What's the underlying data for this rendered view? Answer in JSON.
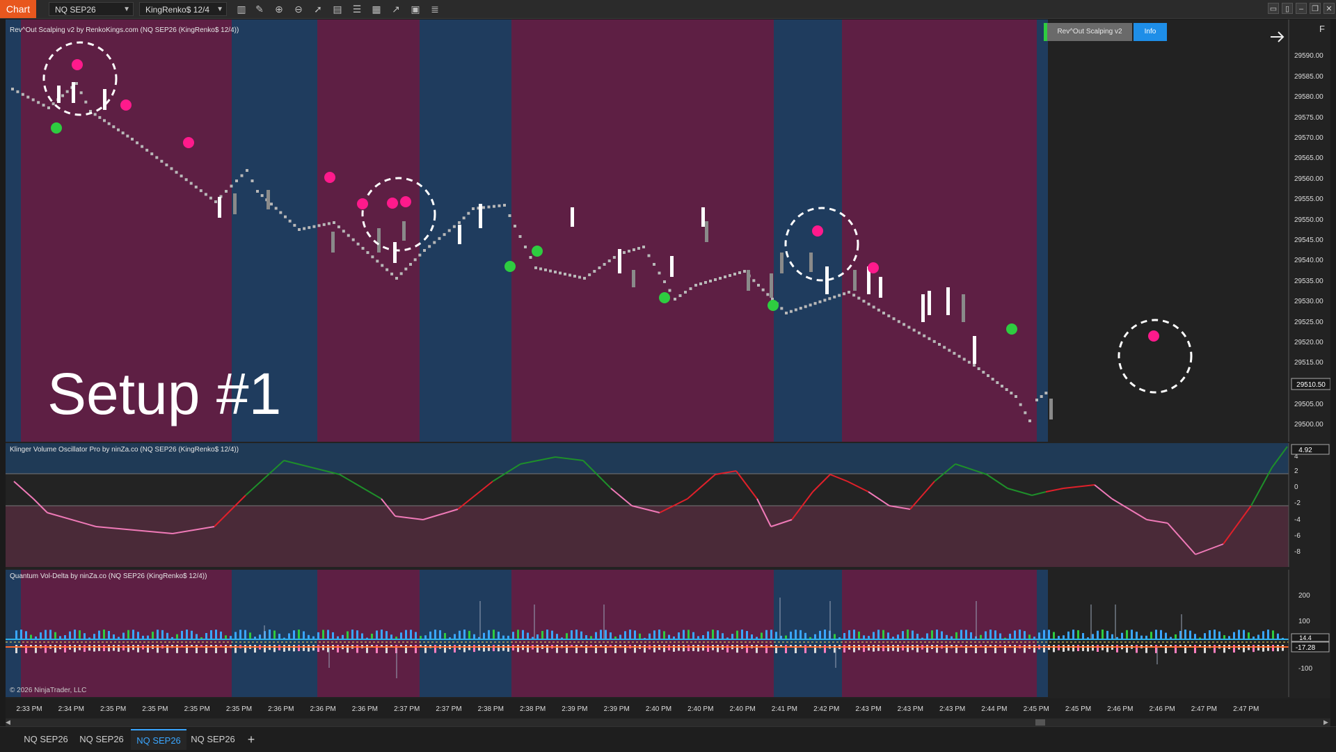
{
  "toolbar": {
    "app_label": "Chart",
    "instrument": "NQ SEP26",
    "bar_type": "KingRenko$ 12/4",
    "icons": [
      "bars-icon",
      "draw-icon",
      "zoom-in-icon",
      "zoom-out-icon",
      "pointer-icon",
      "data-box-icon",
      "template-icon",
      "properties-icon",
      "strategy-icon",
      "chart-trader-icon",
      "indicators-icon"
    ],
    "window_buttons": [
      "tile",
      "tile-2",
      "minimize",
      "restore",
      "close"
    ]
  },
  "panels": {
    "price": {
      "label": "Rev^Out Scalping v2 by RenkoKings.com (NQ SEP26 (KingRenko$ 12/4))",
      "y_labels": [
        "29590.00",
        "29585.00",
        "29580.00",
        "29575.00",
        "29570.00",
        "29565.00",
        "29560.00",
        "29555.00",
        "29550.00",
        "29545.00",
        "29540.00",
        "29535.00",
        "29530.00",
        "29525.00",
        "29520.00",
        "29515.00",
        "29505.00",
        "29500.00"
      ],
      "current_price": "29510.50",
      "overlay_text": "Setup #1",
      "indicator_button": "Rev^Out Scalping v2",
      "info_button": "Info",
      "arrow_icon": "arrow-right-icon",
      "corner_label": "F"
    },
    "klinger": {
      "label": "Klinger Volume Oscillator Pro by ninZa.co (NQ SEP26 (KingRenko$ 12/4))",
      "y_labels": [
        "4",
        "2",
        "0",
        "-2",
        "-4",
        "-6",
        "-8"
      ],
      "current_value": "4.92"
    },
    "voldelta": {
      "label": "Quantum Vol-Delta by ninZa.co (NQ SEP26 (KingRenko$ 12/4))",
      "y_labels": [
        "200",
        "100",
        "-100"
      ],
      "value_upper": "14.4",
      "value_lower": "-17.28",
      "copyright": "© 2026 NinjaTrader, LLC"
    }
  },
  "time_labels": [
    "2:33 PM",
    "2:34 PM",
    "2:35 PM",
    "2:35 PM",
    "2:35 PM",
    "2:35 PM",
    "2:36 PM",
    "2:36 PM",
    "2:36 PM",
    "2:37 PM",
    "2:37 PM",
    "2:38 PM",
    "2:38 PM",
    "2:39 PM",
    "2:39 PM",
    "2:40 PM",
    "2:40 PM",
    "2:40 PM",
    "2:41 PM",
    "2:42 PM",
    "2:43 PM",
    "2:43 PM",
    "2:43 PM",
    "2:44 PM",
    "2:45 PM",
    "2:45 PM",
    "2:46 PM",
    "2:46 PM",
    "2:47 PM",
    "2:47 PM"
  ],
  "tabs": [
    "NQ SEP26",
    "NQ SEP26",
    "NQ SEP26",
    "NQ SEP26"
  ],
  "active_tab": 2,
  "add_tab_label": "+",
  "colors": {
    "bear_zone": "#5e1f44",
    "bull_zone": "#1f3c5e",
    "sell_dot": "#ff1a8c",
    "buy_dot": "#2ecc40",
    "klinger_up": "#1e8f2a",
    "klinger_down": "#e0202a",
    "klinger_weak": "#f07ab8",
    "info_button": "#1e8ee8",
    "app_badge": "#e8571e"
  }
}
